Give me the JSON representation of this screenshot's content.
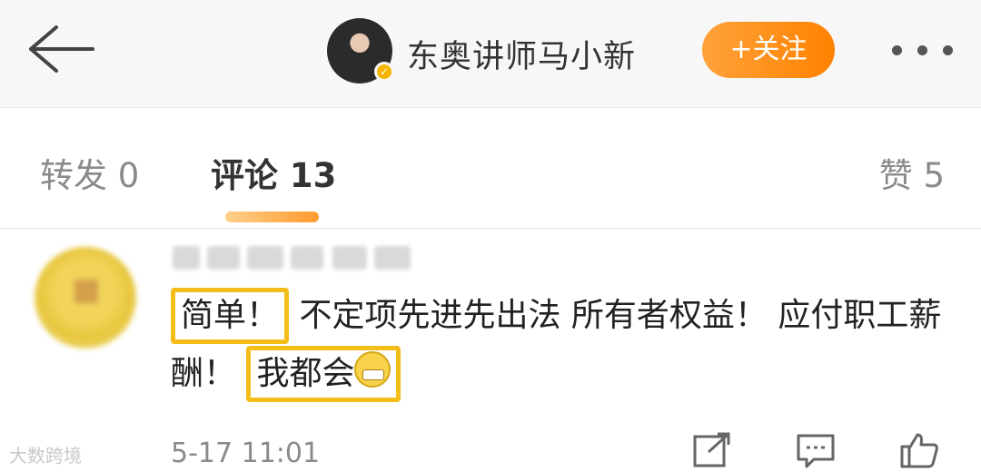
{
  "header": {
    "user_name": "东奥讲师马小新",
    "follow_label": "+关注",
    "icons": {
      "back": "back-arrow-icon",
      "verified": "verified-badge-icon",
      "more": "more-dots-icon"
    },
    "accent_color": "#ff8200"
  },
  "tabs": {
    "repost": "转发 0",
    "comment": "评论 13",
    "like": "赞 5",
    "active": "comment"
  },
  "comment": {
    "highlight_1": "简单！",
    "text_middle": "不定项先进先出法 所有者权益！ 应付职工薪酬！",
    "highlight_2": "我都会",
    "emoji": "grin-emoji-icon",
    "timestamp": "5-17 11:01",
    "actions": [
      "share-icon",
      "comment-icon",
      "like-icon"
    ],
    "highlight_color": "#f3be1a"
  },
  "watermark": "大数跨境"
}
